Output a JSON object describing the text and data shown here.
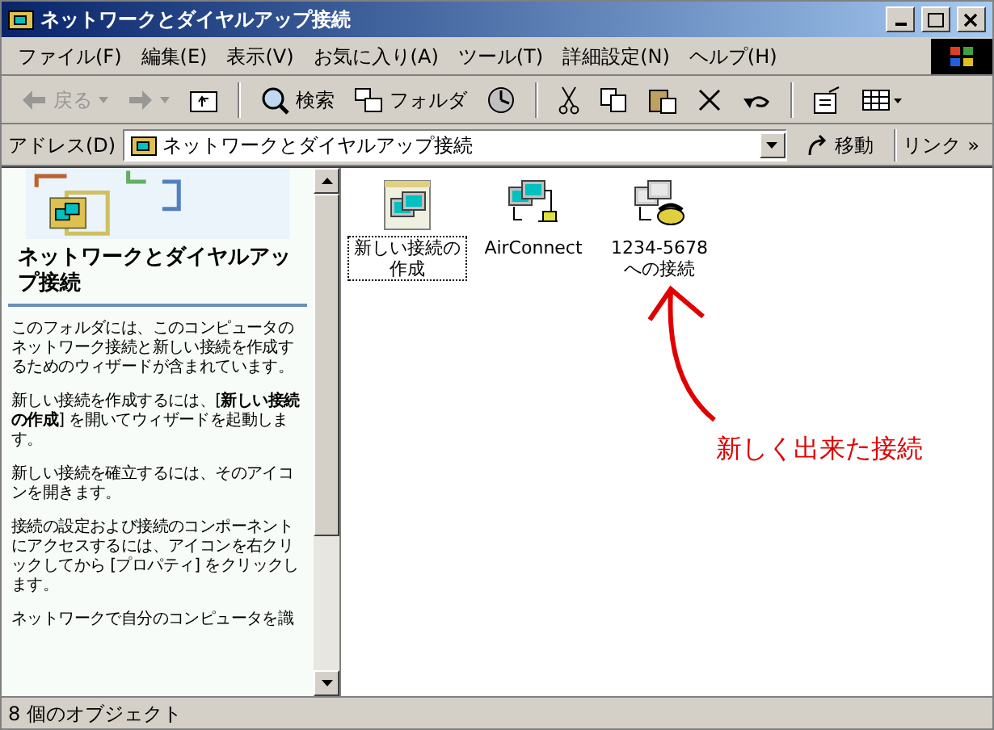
{
  "window": {
    "title": "ネットワークとダイヤルアップ接続"
  },
  "menu": [
    "ファイル(F)",
    "編集(E)",
    "表示(V)",
    "お気に入り(A)",
    "ツール(T)",
    "詳細設定(N)",
    "ヘルプ(H)"
  ],
  "toolbar": [
    {
      "kind": "back",
      "label": "戻る",
      "disabled": true
    },
    {
      "kind": "forward",
      "disabled": true
    },
    {
      "kind": "up",
      "disabled": false
    },
    {
      "kind": "sep"
    },
    {
      "kind": "search",
      "label": "検索",
      "disabled": false
    },
    {
      "kind": "folders",
      "label": "フォルダ",
      "disabled": false
    },
    {
      "kind": "history",
      "disabled": false
    },
    {
      "kind": "sep"
    },
    {
      "kind": "cut",
      "disabled": false
    },
    {
      "kind": "copy",
      "disabled": false
    },
    {
      "kind": "paste",
      "disabled": false
    },
    {
      "kind": "delete",
      "disabled": false
    },
    {
      "kind": "undo",
      "disabled": false
    },
    {
      "kind": "sep"
    },
    {
      "kind": "properties",
      "disabled": false
    },
    {
      "kind": "views",
      "disabled": false
    }
  ],
  "address": {
    "label": "アドレス(D)",
    "value": "ネットワークとダイヤルアップ接続",
    "go": "移動",
    "links": "リンク",
    "more": "»"
  },
  "sidebar": {
    "title": "ネットワークとダイヤルアップ接続",
    "paragraphs": [
      "このフォルダには、このコンピュータのネットワーク接続と新しい接続を作成するためのウィザードが含まれています。",
      "新しい接続を作成するには、[**新しい接続の作成**] を開いてウィザードを起動します。",
      "新しい接続を確立するには、そのアイコンを開きます。",
      "接続の設定および接続のコンポーネントにアクセスするには、アイコンを右クリックしてから [プロパティ] をクリックします。",
      "ネットワークで自分のコンピュータを識"
    ]
  },
  "items": [
    {
      "kind": "wizard",
      "label": "新しい接続の作成",
      "selected": true
    },
    {
      "kind": "lan",
      "label": "AirConnect",
      "selected": false
    },
    {
      "kind": "dialup",
      "label": "1234-5678 への接続",
      "selected": false
    }
  ],
  "annotation": "新しく出来た接続",
  "status_bar": "8 個のオブジェクト"
}
